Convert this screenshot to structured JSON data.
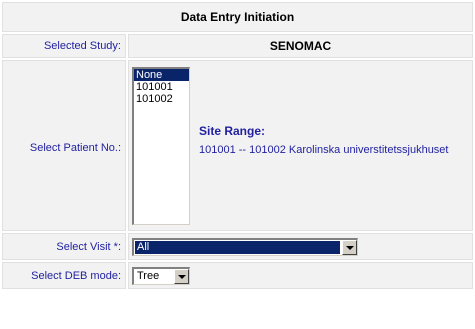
{
  "header": {
    "title": "Data Entry Initiation"
  },
  "study": {
    "label": "Selected Study:",
    "value": "SENOMAC"
  },
  "patient": {
    "label": "Select Patient No.:",
    "options": [
      "None",
      "101001",
      "101002"
    ],
    "selected": "None"
  },
  "site": {
    "title": "Site Range:",
    "range": "101001 -- 101002 Karolinska universtitetssjukhuset"
  },
  "visit": {
    "label": "Select Visit *:",
    "value": "All"
  },
  "deb": {
    "label": "Select DEB mode:",
    "value": "Tree"
  },
  "colors": {
    "label_text": "#1f1fa0",
    "selection": "#0a246a",
    "cell_bg": "#f2f2f2"
  }
}
